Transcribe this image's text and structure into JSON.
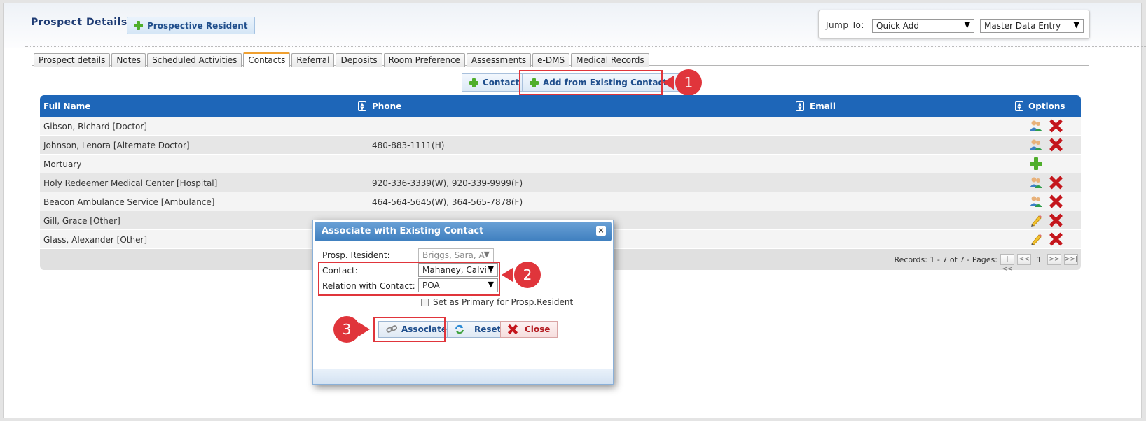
{
  "header": {
    "title": "Prospect Details",
    "prospective_resident_button": "Prospective Resident",
    "jump_to_label": "Jump To:",
    "jump_select_1": "Quick Add",
    "jump_select_2": "Master Data Entry"
  },
  "tabs": [
    {
      "label": "Prospect details"
    },
    {
      "label": "Notes"
    },
    {
      "label": "Scheduled Activities"
    },
    {
      "label": "Contacts",
      "active": true
    },
    {
      "label": "Referral"
    },
    {
      "label": "Deposits"
    },
    {
      "label": "Room Preference"
    },
    {
      "label": "Assessments"
    },
    {
      "label": "e-DMS"
    },
    {
      "label": "Medical Records"
    }
  ],
  "actions": {
    "contact_button": "Contact",
    "add_existing_button": "Add from Existing Contacts"
  },
  "grid": {
    "columns": [
      "Full Name",
      "Phone",
      "Email",
      "Options"
    ],
    "rows": [
      {
        "name": "Gibson, Richard [Doctor]",
        "phone": "",
        "email": "",
        "options": [
          "contact-icon",
          "delete-icon"
        ]
      },
      {
        "name": "Johnson, Lenora [Alternate Doctor]",
        "phone": "480-883-1111(H)",
        "email": "",
        "options": [
          "contact-icon",
          "delete-icon"
        ]
      },
      {
        "name": "Mortuary",
        "phone": "",
        "email": "",
        "options": [
          "add-icon"
        ]
      },
      {
        "name": "Holy Redeemer Medical Center [Hospital]",
        "phone": "920-336-3339(W), 920-339-9999(F)",
        "email": "",
        "options": [
          "contact-icon",
          "delete-icon"
        ]
      },
      {
        "name": "Beacon Ambulance Service [Ambulance]",
        "phone": "464-564-5645(W), 364-565-7878(F)",
        "email": "",
        "options": [
          "contact-icon",
          "delete-icon"
        ]
      },
      {
        "name": "Gill, Grace [Other]",
        "phone": "",
        "email": "",
        "options": [
          "edit-icon",
          "delete-icon"
        ]
      },
      {
        "name": "Glass, Alexander [Other]",
        "phone": "",
        "email": "",
        "options": [
          "edit-icon",
          "delete-icon"
        ]
      }
    ],
    "records_text": "Records: 1 - 7 of 7 - Pages:",
    "current_page": "1"
  },
  "modal": {
    "title": "Associate with Existing Contact",
    "close_glyph": "×",
    "resident_label": "Prosp. Resident:",
    "resident_value": "Briggs, Sara, A",
    "contact_label": "Contact:",
    "contact_value": "Mahaney, Calvin",
    "relation_label": "Relation with Contact:",
    "relation_value": "POA",
    "primary_checkbox_label": "Set as Primary for Prosp.Resident",
    "associate_button": "Associate",
    "reset_button": "Reset",
    "close_button": "Close"
  },
  "callouts": [
    "1",
    "2",
    "3"
  ],
  "colors": {
    "grid_header": "#1e66b8",
    "callout_red": "#e0353b",
    "tab_active_accent": "#f0a030",
    "delete_red": "#c4161c",
    "plus_green": "#4fae2b"
  }
}
